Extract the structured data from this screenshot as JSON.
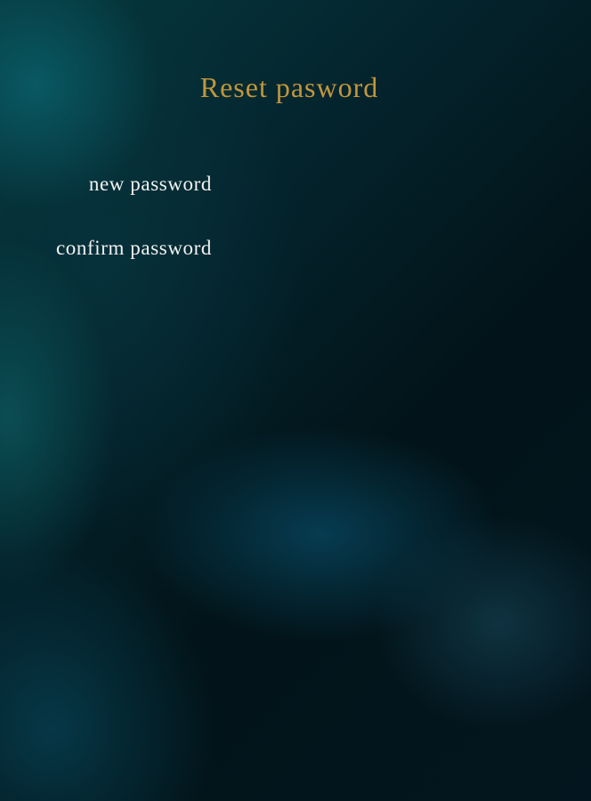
{
  "page": {
    "title": "Reset pasword",
    "title_color": "#c2963c"
  },
  "form": {
    "new_password": {
      "label": "new password",
      "value": "",
      "placeholder": ""
    },
    "confirm_password": {
      "label": "confirm password",
      "value": "",
      "placeholder": ""
    }
  }
}
